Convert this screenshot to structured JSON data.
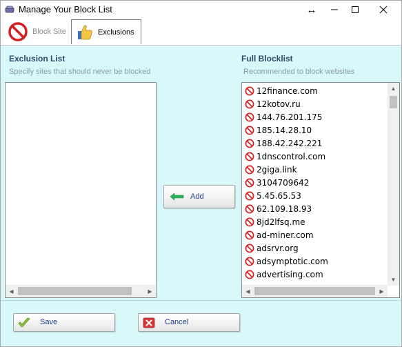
{
  "window": {
    "title": "Manage Your Block List",
    "controls": {
      "resize": "↔",
      "minimize": "—",
      "maximize": "☐",
      "close": "✕"
    }
  },
  "tabs": [
    {
      "label": "Block Site",
      "icon": "no-entry-icon",
      "active": false
    },
    {
      "label": "Exclusions",
      "icon": "thumbs-up-icon",
      "active": true
    }
  ],
  "exclusion": {
    "title": "Exclusion List",
    "subtitle": "Specify sites that should never be blocked",
    "items": []
  },
  "blocklist": {
    "title": "Full Blocklist",
    "subtitle": "Recommended to block websites",
    "items": [
      "12finance.com",
      "12kotov.ru",
      "144.76.201.175",
      "185.14.28.10",
      "188.42.242.221",
      "1dnscontrol.com",
      "2giga.link",
      "3104709642",
      "5.45.65.53",
      "62.109.18.93",
      "8jd2lfsq.me",
      "ad-miner.com",
      "adsrvr.org",
      "adsymptotic.com",
      "advertising.com"
    ]
  },
  "buttons": {
    "add": "Add",
    "save": "Save",
    "cancel": "Cancel"
  },
  "colors": {
    "panel_bg": "#d9f8f9",
    "title_text": "#2c4a6a",
    "button_text": "#1e3c8c",
    "ban_red": "#d42020"
  }
}
